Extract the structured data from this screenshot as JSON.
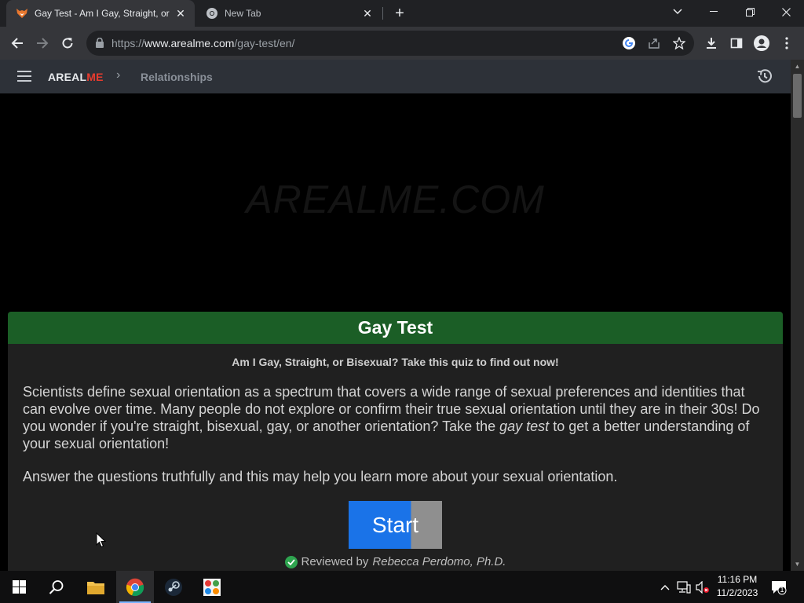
{
  "browser": {
    "tabs": [
      {
        "title": "Gay Test - Am I Gay, Straight, or",
        "favicon": "arealme-fox-icon",
        "active": true
      },
      {
        "title": "New Tab",
        "favicon": "chrome-icon",
        "active": false
      }
    ],
    "url_host_prefix": "https://",
    "url_host": "www.arealme.com",
    "url_path": "/gay-test/en/"
  },
  "site": {
    "logo_part1": "AREAL",
    "logo_part2": "ME",
    "breadcrumb_sep": "›",
    "breadcrumb": "Relationships",
    "watermark": "AREALME.COM"
  },
  "quiz": {
    "title": "Gay Test",
    "subtitle": "Am I Gay, Straight, or Bisexual? Take this quiz to find out now!",
    "para1_a": "Scientists define sexual orientation as a spectrum that covers a wide range of sexual preferences and identities that can evolve over time. Many people do not explore or confirm their true sexual orientation until they are in their 30s! Do you wonder if you're straight, bisexual, gay, or another orientation? Take the ",
    "para1_em": "gay test",
    "para1_b": " to get a better understanding of your sexual orientation!",
    "para2": "Answer the questions truthfully and this may help you learn more about your sexual orientation.",
    "start_label": "Start",
    "reviewed_label": "Reviewed by",
    "reviewer": "Rebecca Perdomo, Ph.D."
  },
  "taskbar": {
    "time": "11:16 PM",
    "date": "11/2/2023",
    "notification_count": "1"
  },
  "colors": {
    "header_green": "#1b5e26",
    "start_blue": "#1a73e8",
    "logo_red": "#e63b2e"
  }
}
